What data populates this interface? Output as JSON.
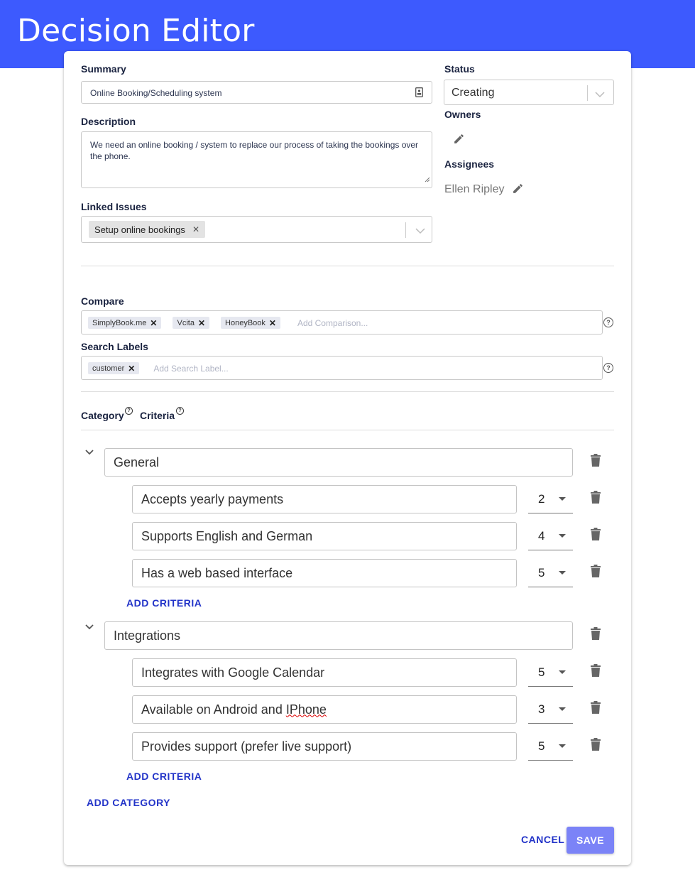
{
  "page": {
    "title": "Decision Editor"
  },
  "summary": {
    "label": "Summary",
    "value": "Online Booking/Scheduling system"
  },
  "description": {
    "label": "Description",
    "value": "We need an online booking / system to replace our process of taking the bookings over the phone."
  },
  "linked_issues": {
    "label": "Linked Issues",
    "chips": [
      "Setup online bookings"
    ]
  },
  "status": {
    "label": "Status",
    "value": "Creating"
  },
  "owners": {
    "label": "Owners"
  },
  "assignees": {
    "label": "Assignees",
    "value": "Ellen Ripley"
  },
  "compare": {
    "label": "Compare",
    "tags": [
      "SimplyBook.me",
      "Vcita",
      "HoneyBook"
    ],
    "placeholder": "Add Comparison..."
  },
  "search_labels": {
    "label": "Search Labels",
    "tags": [
      "customer"
    ],
    "placeholder": "Add Search Label..."
  },
  "headers": {
    "category": "Category",
    "criteria": "Criteria"
  },
  "categories": [
    {
      "name": "General",
      "criteria": [
        {
          "name": "Accepts yearly payments",
          "weight": "2"
        },
        {
          "name": "Supports English and German",
          "weight": "4"
        },
        {
          "name": "Has a web based interface",
          "weight": "5"
        }
      ],
      "add_label": "ADD CRITERIA"
    },
    {
      "name": "Integrations",
      "criteria": [
        {
          "name": "Integrates with Google Calendar",
          "weight": "5"
        },
        {
          "name": "Available on Android and ",
          "name_tail": "IPhone",
          "weight": "3"
        },
        {
          "name": "Provides support (prefer live support)",
          "weight": "5"
        }
      ],
      "add_label": "ADD CRITERIA"
    }
  ],
  "add_category_label": "ADD CATEGORY",
  "actions": {
    "cancel": "CANCEL",
    "save": "SAVE"
  },
  "colors": {
    "header": "#3d5afe",
    "accent": "#2233c8",
    "save_button": "#7b83f7"
  }
}
